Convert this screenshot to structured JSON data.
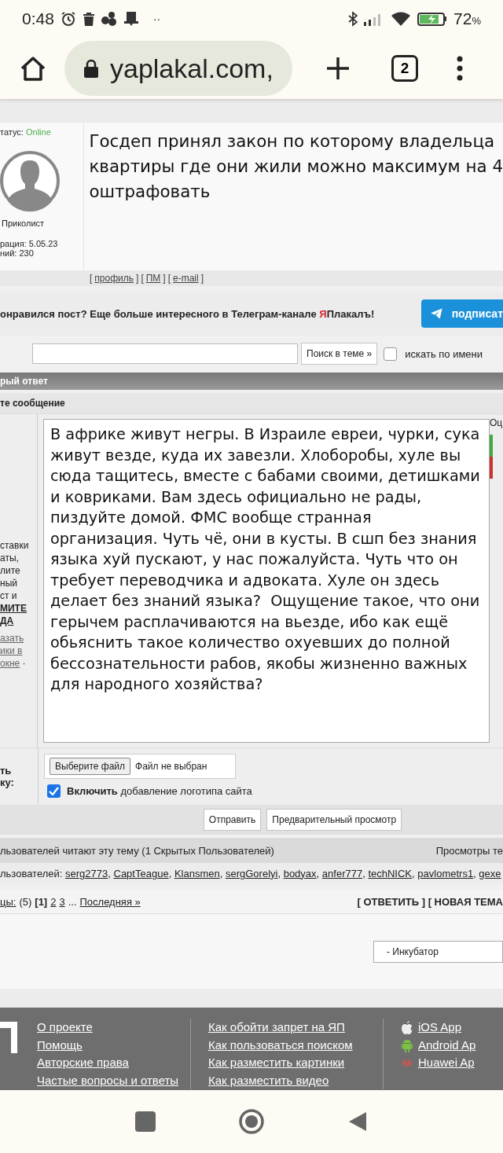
{
  "status_bar": {
    "time": "0:48",
    "more": "··",
    "battery": "72",
    "battery_unit": "%"
  },
  "browser": {
    "url": "yaplakal.com,",
    "tab_count": "2"
  },
  "post": {
    "status_label": "татус:",
    "status_value": "Online",
    "rank": "Приколист",
    "reg": "рация: 5.05.23",
    "posts": "ний: 230",
    "text_lines": [
      "Госдеп принял закон по которому владельца",
      "квартиры где они жили можно максимум на 4",
      "оштрафовать"
    ],
    "links": [
      "профиль",
      "ПМ",
      "e-mail"
    ],
    "bracket_open": "[",
    "bracket_close": "]"
  },
  "telegram": {
    "text_before": "онравился пост? Еще больше интересного в Телеграм-канале ",
    "brand_accent": "Я",
    "brand_rest": "Плакалъ",
    "text_after": "!",
    "button": "подписат"
  },
  "search": {
    "button": "Поиск в теме »",
    "by_name_label": "искать по имени",
    "by_name_checked": false
  },
  "reply": {
    "header": "рый ответ",
    "subheader": "те сообщение",
    "side_lines": [
      "ставки",
      "аты,",
      "лите",
      "ный",
      "ст и"
    ],
    "side_bold_link": [
      "МИТЕ",
      "ДА"
    ],
    "side_links": [
      "азать",
      "ики в",
      "окне"
    ],
    "side_dot": "·",
    "rating_label": "Оц",
    "message": "В африке живут негры. В Израиле евреи, чурки, сука живут везде, куда их завезли. Хлоборобы, хуле вы сюда тащитесь, вместе с бабами своими, детишками и ковриками. Вам здесь официально не рады, пиздуйте домой. ФМС вообще странная организация. Чуть чё, они в кусты. В сшп без знания языка хуй пускают, у нас пожалуйста. Чуть что он требует переводчика и адвоката. Хуле он здесь делает без знаний языка?  Ощущение такое, что они герычем расплачиваются на вьезде, ибо как ещё обьяснить такое количество охуевших до полной бессознательности рабов, якобы жизненно важных для народного хозяйства?",
    "file_label": [
      "ть",
      "ку:"
    ],
    "file_button": "Выберите файл",
    "file_status": "Файл не выбран",
    "logo_bold": "Включить",
    "logo_rest": " добавление логотипа сайта",
    "logo_checked": true,
    "buttons": [
      "Отправить",
      "Предварительный просмотр"
    ]
  },
  "readers": {
    "text": "льзователей читают эту тему (1 Скрытых Пользователей)",
    "views": "Просмотры те",
    "users_label": "льзователей:",
    "separator": ",",
    "users": [
      "serg2773",
      "CaptTeague",
      "Klansmen",
      "sergGorelyi",
      "bodyax",
      "anfer777",
      "techNICK",
      "pavlometrs1",
      "gexe"
    ]
  },
  "pages": {
    "label": "цы:",
    "count": "(5)",
    "items": [
      {
        "label": "[1]",
        "selected": true
      },
      {
        "label": "2",
        "selected": false
      },
      {
        "label": "3",
        "selected": false
      }
    ],
    "ellipsis": "...",
    "last": "Последняя »",
    "actions": "[ ОТВЕТИТЬ ] [ НОВАЯ ТЕМА"
  },
  "forum_select": "- Инкубатор",
  "footer": {
    "col1": [
      "О проекте",
      "Помощь",
      "Авторские права",
      "Частые вопросы и ответы"
    ],
    "col2": [
      "Как обойти запрет на ЯП",
      "Как пользоваться поиском",
      "Как разместить картинки",
      "Как разместить видео"
    ],
    "apps": [
      {
        "kind": "apple",
        "label": "iOS App"
      },
      {
        "kind": "android",
        "label": "Android Ap"
      },
      {
        "kind": "huawei",
        "label": "Huawei Ap"
      }
    ]
  }
}
